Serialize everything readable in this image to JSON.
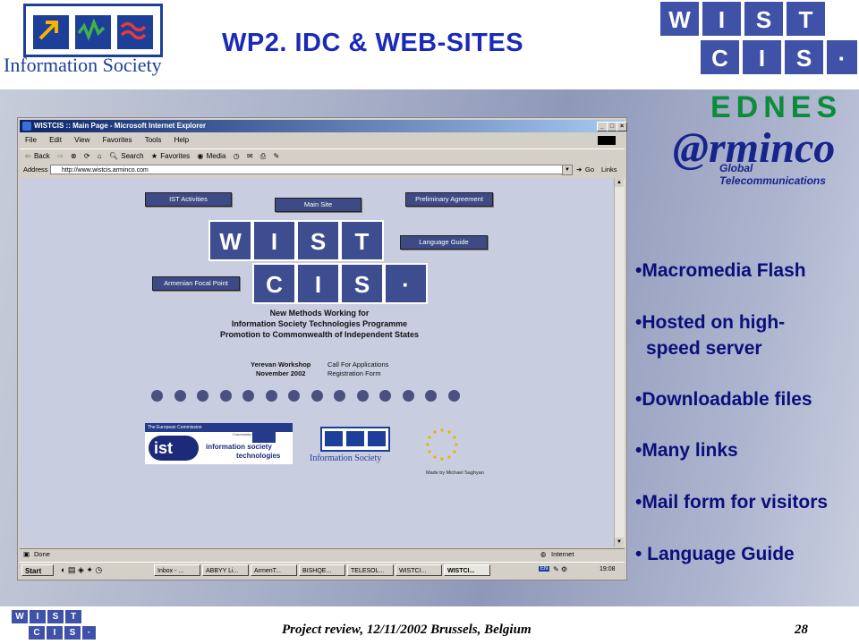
{
  "header": {
    "title": "WP2. IDC & WEB-SITES",
    "is_logo_text": "Information Society"
  },
  "logos": {
    "wistcis_top": [
      "W",
      "I",
      "S",
      "T"
    ],
    "wistcis_bottom": [
      "C",
      "I",
      "S",
      "·"
    ],
    "ednes": "EDNES",
    "arminco": "@rminco",
    "arminco_sub": "Global Telecommunications"
  },
  "bullets": [
    "•Macromedia Flash",
    "•Hosted on high-",
    "speed server",
    "•Downloadable files",
    "•Many links",
    "•Mail form for visitors",
    "• Language Guide"
  ],
  "browser": {
    "window_title": "WISTCIS :: Main Page - Microsoft Internet Explorer",
    "menu": [
      "File",
      "Edit",
      "View",
      "Favorites",
      "Tools",
      "Help"
    ],
    "toolbar": [
      "Back",
      "Search",
      "Favorites",
      "Media"
    ],
    "address_label": "Address",
    "address_value": "http://www.wistcis.arminco.com",
    "go_label": "Go",
    "links_label": "Links",
    "status_left": "Done",
    "status_right": "Internet",
    "taskbar": {
      "start": "Start",
      "tasks": [
        "Inbox - ...",
        "ABBYY Li...",
        "ArmenT...",
        "BISHQE...",
        "TELESOL...",
        "WISTCI...",
        "WISTCI..."
      ],
      "lang": "EN",
      "clock": "19:08"
    }
  },
  "site": {
    "nav": {
      "ist_activities": "IST Activities",
      "main_site": "Main Site",
      "preliminary_agreement": "Preliminary Agreement",
      "language_guide": "Language Guide",
      "armenian_focal_point": "Armenian Focal Point"
    },
    "tagline": [
      "New Methods Working for",
      "Information Society Technologies Programme",
      "Promotion to Commonwealth of Independent States"
    ],
    "workshop_left": [
      "Yerevan Workshop",
      "November 2002"
    ],
    "workshop_right": [
      "Call For Applications",
      "Registration Form"
    ],
    "dot_count": 14,
    "ec_banner": "The European Commission",
    "ec_sub": "Community Research",
    "ist_logo": "ist",
    "ist_text": [
      "information society",
      "technologies"
    ],
    "is_logo_text": "Information Society",
    "credit": "Made by Michael Saghyan"
  },
  "footer": {
    "text": "Project review, 12/11/2002 Brussels, Belgium",
    "page": "28"
  }
}
